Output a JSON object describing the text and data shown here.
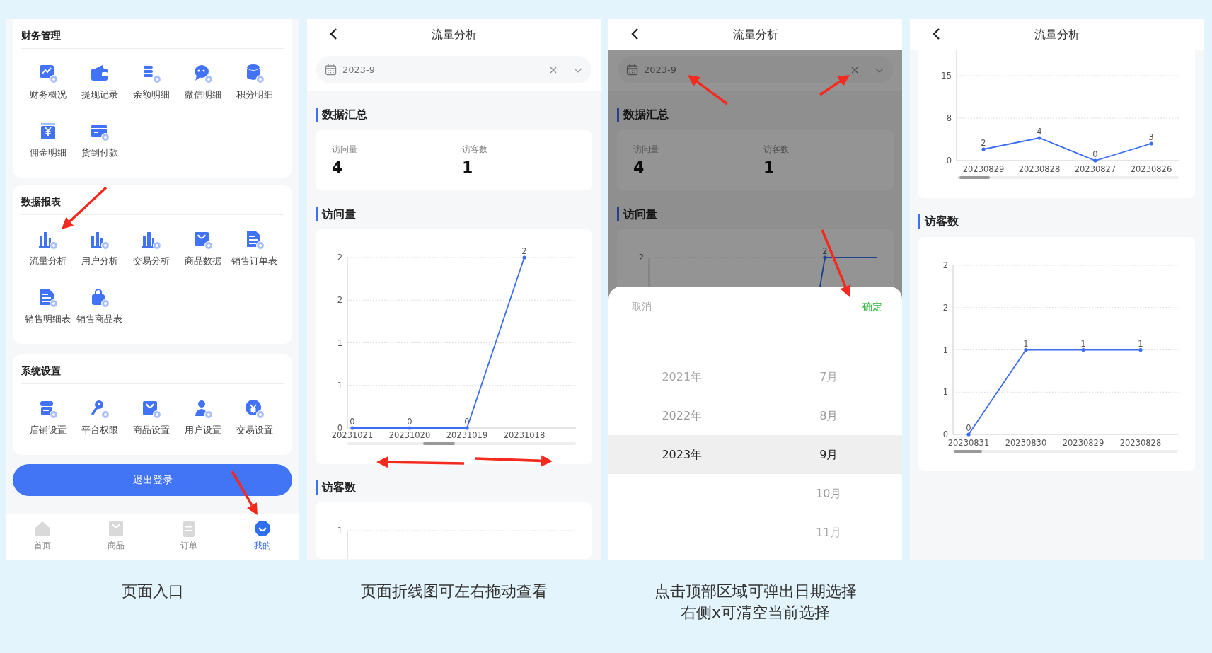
{
  "screens": [
    {
      "kind": "menu",
      "sections": [
        {
          "title": "财务管理",
          "items": [
            {
              "label": "财务概况"
            },
            {
              "label": "提现记录"
            },
            {
              "label": "余额明细"
            },
            {
              "label": "微信明细"
            },
            {
              "label": "积分明细"
            },
            {
              "label": "佣金明细"
            },
            {
              "label": "货到付款"
            }
          ]
        },
        {
          "title": "数据报表",
          "items": [
            {
              "label": "流量分析"
            },
            {
              "label": "用户分析"
            },
            {
              "label": "交易分析"
            },
            {
              "label": "商品数据"
            },
            {
              "label": "销售订单表"
            },
            {
              "label": "销售明细表"
            },
            {
              "label": "销售商品表"
            }
          ]
        },
        {
          "title": "系统设置",
          "items": [
            {
              "label": "店铺设置"
            },
            {
              "label": "平台权限"
            },
            {
              "label": "商品设置"
            },
            {
              "label": "用户设置"
            },
            {
              "label": "交易设置"
            }
          ]
        }
      ],
      "logout_button": "退出登录",
      "tab_bar": [
        {
          "label": "首页",
          "selected": false
        },
        {
          "label": "商品",
          "selected": false
        },
        {
          "label": "订单",
          "selected": false
        },
        {
          "label": "我的",
          "selected": true
        }
      ]
    },
    {
      "kind": "analysis",
      "header": {
        "title": "流量分析"
      },
      "date_field": {
        "value": "2023-9"
      },
      "summary": {
        "title": "数据汇总",
        "stats": [
          {
            "label": "访问量",
            "value": "4"
          },
          {
            "label": "访客数",
            "value": "1"
          }
        ]
      },
      "visits": {
        "title": "访问量",
        "chart_data": {
          "type": "line",
          "categories": [
            "20231021",
            "20231020",
            "20231019",
            "20231018"
          ],
          "series": [
            {
              "color": "#3c6ef5",
              "values": [
                0,
                0,
                0,
                2
              ]
            }
          ],
          "grid": true,
          "ylim": [
            0,
            2
          ],
          "yticks": [
            {
              "value": 0,
              "label": "0"
            },
            {
              "value": 0.5,
              "label": "1"
            },
            {
              "value": 1,
              "label": "1"
            },
            {
              "value": 1.5,
              "label": "2"
            },
            {
              "value": 2,
              "label": "2"
            }
          ],
          "data_labels": true
        }
      },
      "visitors": {
        "title": "访客数",
        "ytick_label": "1"
      }
    },
    {
      "kind": "picker",
      "header": {
        "title": "流量分析"
      },
      "date_field": {
        "value": "2023-9"
      },
      "summary": {
        "title": "数据汇总",
        "stats": [
          {
            "label": "访问量",
            "value": "4"
          },
          {
            "label": "访客数",
            "value": "1"
          }
        ]
      },
      "visits": {
        "title": "访问量",
        "ytick_label": "2",
        "point_label": "2"
      },
      "picker": {
        "cancel": "取消",
        "confirm": "确定",
        "columns": [
          [
            {
              "label": "2021年",
              "selected": false
            },
            {
              "label": "2022年",
              "selected": false
            },
            {
              "label": "2023年",
              "selected": true
            }
          ],
          [
            {
              "label": "7月",
              "selected": false
            },
            {
              "label": "8月",
              "selected": false
            },
            {
              "label": "9月",
              "selected": true
            },
            {
              "label": "10月",
              "selected": false
            },
            {
              "label": "11月",
              "selected": false
            }
          ]
        ]
      }
    },
    {
      "kind": "charts",
      "header": {
        "title": "流量分析"
      },
      "visits": {
        "chart_data": {
          "type": "line",
          "categories": [
            "20230829",
            "20230828",
            "20230827",
            "20230826"
          ],
          "series": [
            {
              "color": "#3c6ef5",
              "values": [
                2,
                4,
                0,
                3
              ]
            }
          ],
          "grid": true,
          "ylim": [
            0,
            19.5
          ],
          "yticks": [
            {
              "value": 0,
              "label": "0"
            },
            {
              "value": 7.5,
              "label": "8"
            },
            {
              "value": 15,
              "label": "15"
            }
          ],
          "data_labels": true
        }
      },
      "visitors": {
        "title": "访客数",
        "chart_data": {
          "type": "line",
          "categories": [
            "20230831",
            "20230830",
            "20230829",
            "20230828"
          ],
          "series": [
            {
              "color": "#3c6ef5",
              "values": [
                0,
                1,
                1,
                1
              ]
            }
          ],
          "grid": true,
          "ylim": [
            0,
            2
          ],
          "yticks": [
            {
              "value": 0,
              "label": "0"
            },
            {
              "value": 0.5,
              "label": "1"
            },
            {
              "value": 1,
              "label": "1"
            },
            {
              "value": 1.5,
              "label": "2"
            },
            {
              "value": 2,
              "label": "2"
            }
          ],
          "data_labels": true
        }
      }
    }
  ],
  "captions": [
    {
      "lines": [
        "页面入口"
      ]
    },
    {
      "lines": [
        "页面折线图可左右拖动查看"
      ]
    },
    {
      "lines": [
        "点击顶部区域可弹出日期选择",
        "右侧x可清空当前选择"
      ]
    }
  ]
}
